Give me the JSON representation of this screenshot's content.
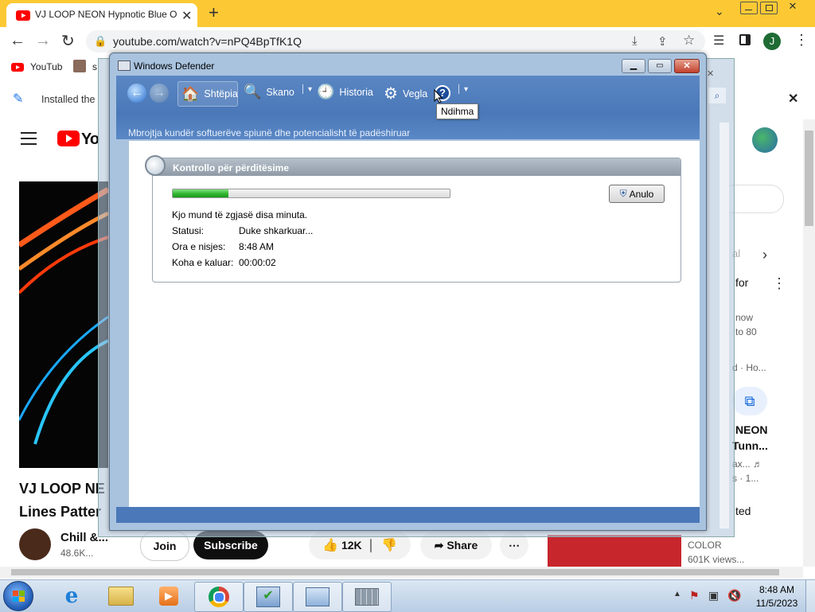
{
  "browser": {
    "tab_title": "VJ LOOP NEON Hypnotic Blue Optical",
    "url": "youtube.com/watch?v=nPQ4BpTfK1Q",
    "bookmark_youtube": "YouTub",
    "bookmark_2": "s",
    "profile_initial": "J",
    "infobar_text": "Installed the"
  },
  "youtube": {
    "title_line1": "VJ LOOP NE",
    "title_line2": "Lines Patter",
    "channel": "Chill &...",
    "subscribers": "48.6K...",
    "join": "Join",
    "subscribe": "Subscribe",
    "likes": "12K",
    "share": "Share",
    "side_al": "al",
    "side_for": "for",
    "side_now": "now",
    "side_to80": "to 80",
    "side_ho": "d · Ho...",
    "side_neon": "NEON",
    "side_tunn": "Tunn...",
    "side_ax": "ax... ♬",
    "side_s1": "s  · 1...",
    "side_ted": "ted",
    "color_label": "COLOR",
    "views": "601K views..."
  },
  "defender": {
    "window_title": "Windows Defender",
    "nav_home": "Shtëpia",
    "nav_scan": "Skano",
    "nav_history": "Historia",
    "nav_tools": "Vegla",
    "tooltip": "Ndihma",
    "subtitle": "Mbrojtja kundër softuerëve spiunë dhe potencialisht të padëshiruar",
    "panel_title": "Kontrollo për përditësime",
    "progress": 0.2,
    "note": "Kjo mund të zgjasë disa minuta.",
    "status_label": "Statusi:",
    "status_value": "Duke shkarkuar...",
    "start_label": "Ora e nisjes:",
    "start_value": "8:48 AM",
    "elapsed_label": "Koha e kaluar:",
    "elapsed_value": "00:00:02",
    "cancel": "Anulo"
  },
  "taskbar": {
    "time": "8:48 AM",
    "date": "11/5/2023"
  },
  "colors": {
    "chrome_tab_bar": "#fcc934",
    "defender_nav": "#4a78b8",
    "progress_green": "#2ab32a"
  }
}
